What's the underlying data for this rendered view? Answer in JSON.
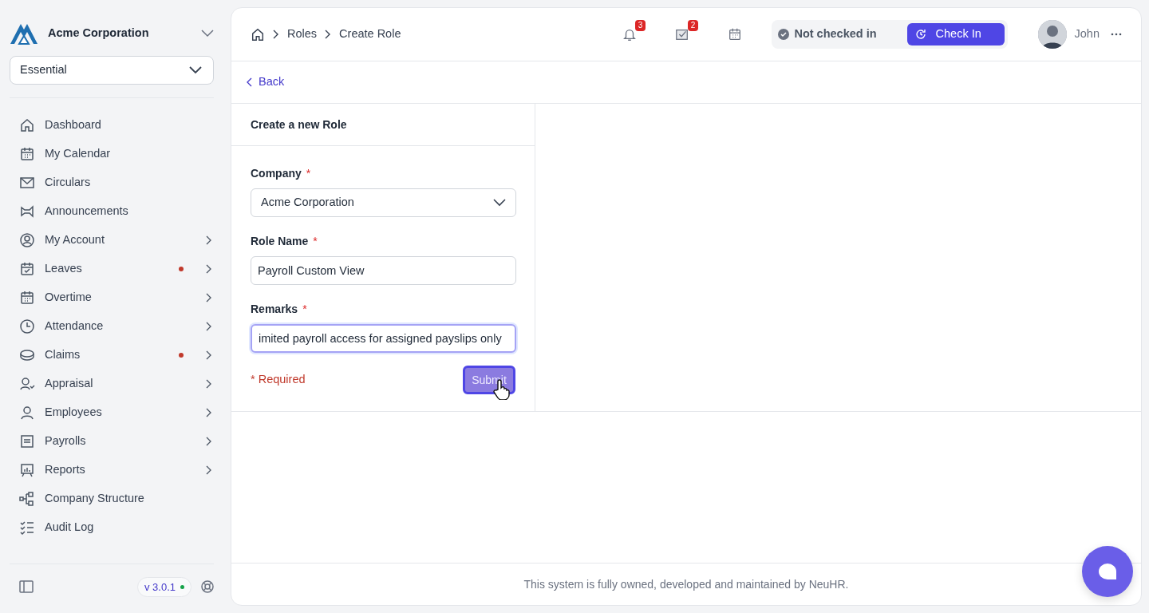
{
  "sidebar": {
    "company": "Acme Corporation",
    "plan_select": {
      "value": "Essential"
    },
    "items": [
      {
        "label": "Dashboard",
        "expandable": false,
        "has_alert": false
      },
      {
        "label": "My Calendar",
        "expandable": false,
        "has_alert": false
      },
      {
        "label": "Circulars",
        "expandable": false,
        "has_alert": false
      },
      {
        "label": "Announcements",
        "expandable": false,
        "has_alert": false
      },
      {
        "label": "My Account",
        "expandable": true,
        "has_alert": false
      },
      {
        "label": "Leaves",
        "expandable": true,
        "has_alert": true
      },
      {
        "label": "Overtime",
        "expandable": true,
        "has_alert": false
      },
      {
        "label": "Attendance",
        "expandable": true,
        "has_alert": false
      },
      {
        "label": "Claims",
        "expandable": true,
        "has_alert": true
      },
      {
        "label": "Appraisal",
        "expandable": true,
        "has_alert": false
      },
      {
        "label": "Employees",
        "expandable": true,
        "has_alert": false
      },
      {
        "label": "Payrolls",
        "expandable": true,
        "has_alert": false
      },
      {
        "label": "Reports",
        "expandable": true,
        "has_alert": false
      },
      {
        "label": "Company Structure",
        "expandable": false,
        "has_alert": false
      },
      {
        "label": "Audit Log",
        "expandable": false,
        "has_alert": false
      }
    ],
    "version": "v 3.0.1",
    "version_online": true
  },
  "header": {
    "breadcrumbs": [
      "Roles",
      "Create Role"
    ],
    "notifications": "3",
    "tasks": "2",
    "checkin_status": "Not checked in",
    "checkin_button": "Check In",
    "user": "John"
  },
  "back_link": "Back",
  "form": {
    "title": "Create a new Role",
    "fields": [
      {
        "kind": "select",
        "label": "Company",
        "required_mark": "*",
        "value": "Acme Corporation",
        "focused": false
      },
      {
        "kind": "text",
        "label": "Role Name",
        "required_mark": "*",
        "value": "Payroll Custom View",
        "focused": false
      },
      {
        "kind": "text",
        "label": "Remarks",
        "required_mark": "*",
        "value": "imited payroll access for assigned payslips only",
        "focused": true
      }
    ],
    "required_note": "* Required",
    "submit": "Submit"
  },
  "footer": "This system is fully owned, developed and maintained by NeuHR."
}
